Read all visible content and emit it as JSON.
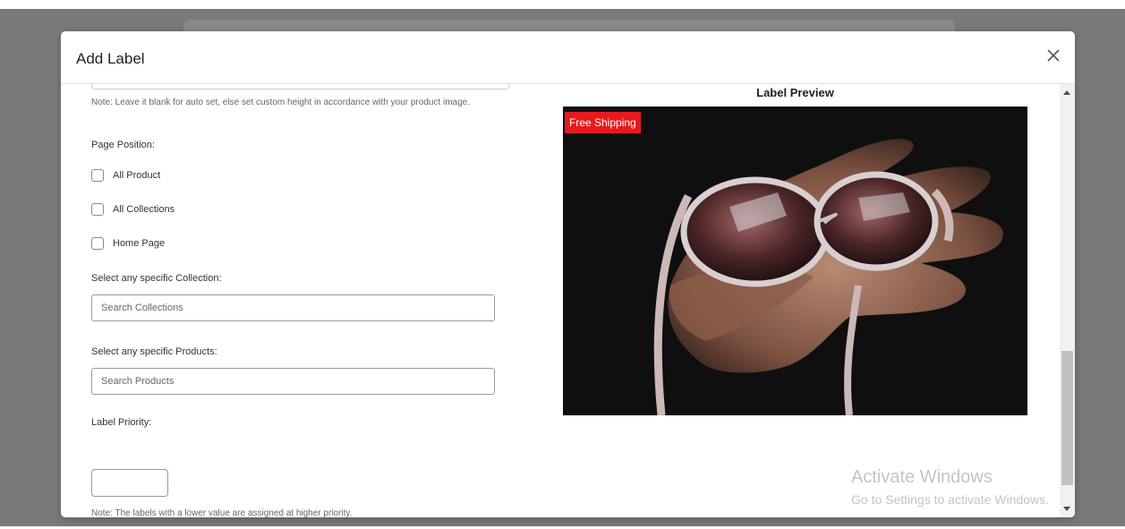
{
  "modal": {
    "title": "Add Label",
    "close_icon": "close-icon"
  },
  "form": {
    "height_note": "Note: Leave it blank for auto set, else set custom height in accordance with your product image.",
    "page_position_label": "Page Position:",
    "checkboxes": [
      {
        "label": "All Product",
        "checked": false
      },
      {
        "label": "All Collections",
        "checked": false
      },
      {
        "label": "Home Page",
        "checked": false
      }
    ],
    "collection_label": "Select any specific Collection:",
    "collection_placeholder": "Search Collections",
    "products_label": "Select any specific Products:",
    "products_placeholder": "Search Products",
    "priority_label": "Label Priority:",
    "priority_value": "",
    "priority_note": "Note: The labels with a lower value are assigned at higher priority."
  },
  "preview": {
    "title": "Label Preview",
    "badge_text": "Free Shipping",
    "badge_color": "#e8191c"
  },
  "watermark": {
    "line1": "Activate Windows",
    "line2": "Go to Settings to activate Windows."
  }
}
